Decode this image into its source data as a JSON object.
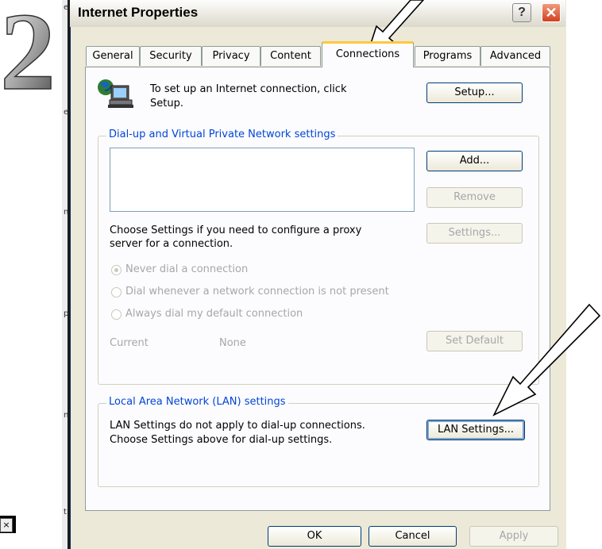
{
  "step_number": "2",
  "window": {
    "title": "Internet Properties",
    "help_glyph": "?",
    "close_glyph": "✕"
  },
  "tabs": [
    {
      "label": "General",
      "active": false
    },
    {
      "label": "Security",
      "active": false
    },
    {
      "label": "Privacy",
      "active": false
    },
    {
      "label": "Content",
      "active": false
    },
    {
      "label": "Connections",
      "active": true
    },
    {
      "label": "Programs",
      "active": false
    },
    {
      "label": "Advanced",
      "active": false
    }
  ],
  "setup": {
    "text_line1": "To set up an Internet connection, click",
    "text_line2": "Setup.",
    "button": "Setup..."
  },
  "dialup": {
    "legend": "Dial-up and Virtual Private Network settings",
    "add_button": "Add...",
    "remove_button": "Remove",
    "settings_text_line1": "Choose Settings if you need to configure a proxy",
    "settings_text_line2": "server for a connection.",
    "settings_button": "Settings...",
    "radio_options": [
      {
        "label": "Never dial a connection",
        "selected": true
      },
      {
        "label": "Dial whenever a network connection is not present",
        "selected": false
      },
      {
        "label": "Always dial my default connection",
        "selected": false
      }
    ],
    "current_label": "Current",
    "current_value": "None",
    "set_default_button": "Set Default"
  },
  "lan": {
    "legend": "Local Area Network (LAN) settings",
    "text_line1": "LAN Settings do not apply to dial-up connections.",
    "text_line2": "Choose Settings above for dial-up settings.",
    "button": "LAN Settings..."
  },
  "footer": {
    "ok_button": "OK",
    "cancel_button": "Cancel",
    "apply_button": "Apply"
  },
  "background": {
    "close_glyph": "×",
    "edge_chars": [
      "e",
      "e",
      "n",
      "p",
      "n",
      "t"
    ]
  },
  "colors": {
    "dialog_bg": "#ece9d8",
    "tab_highlight": "#ffc83c",
    "legend_text": "#0046d5",
    "button_border": "#003c74",
    "close_red": "#d2411e"
  }
}
